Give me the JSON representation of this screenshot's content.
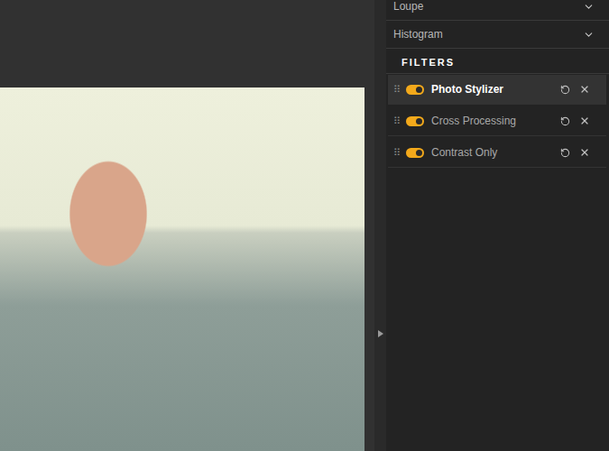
{
  "panels": [
    {
      "label": "Loupe",
      "expanded": false
    },
    {
      "label": "Histogram",
      "expanded": false
    }
  ],
  "filters_heading": "FILTERS",
  "filters": [
    {
      "name": "Photo Stylizer",
      "on": true,
      "selected": true
    },
    {
      "name": "Cross Processing",
      "on": true,
      "selected": false
    },
    {
      "name": "Contrast Only",
      "on": true,
      "selected": false
    }
  ]
}
